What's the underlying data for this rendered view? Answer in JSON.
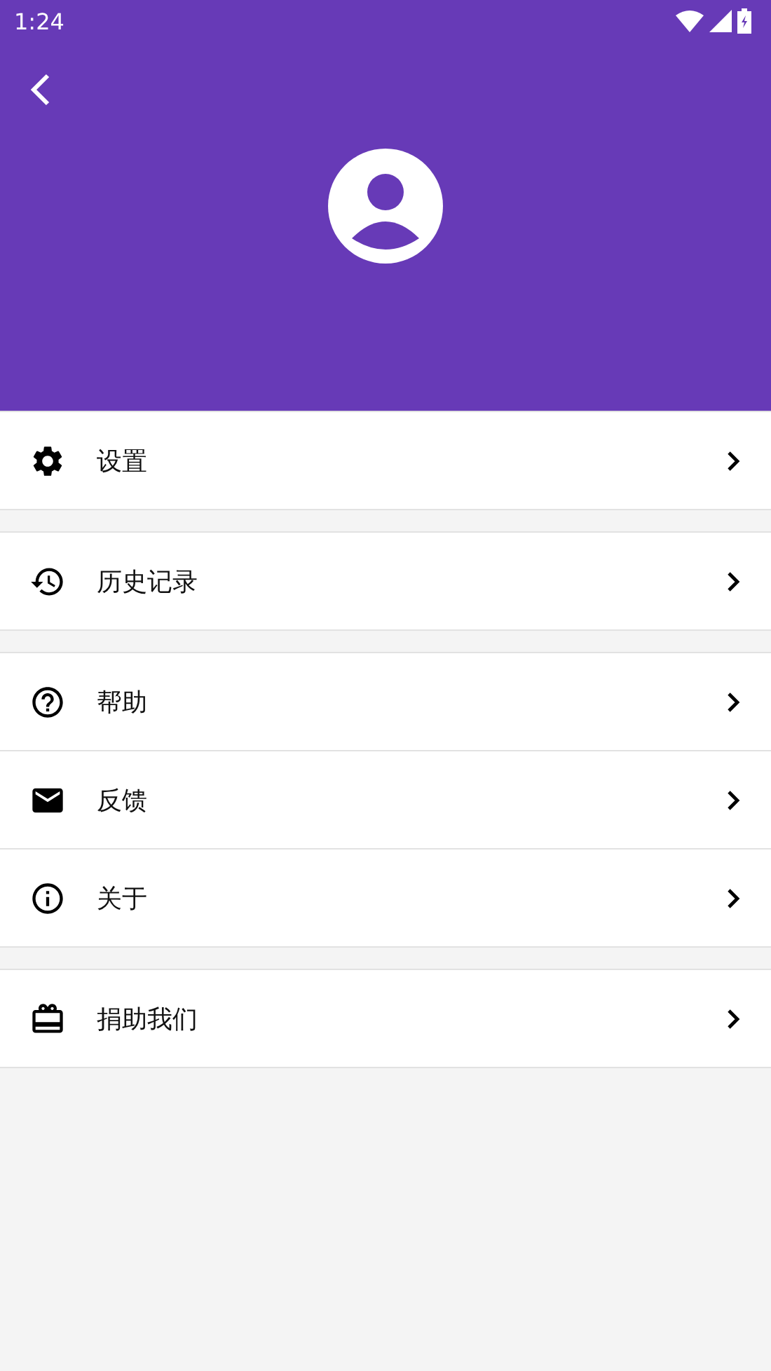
{
  "status_bar": {
    "time": "1:24"
  },
  "groups": [
    {
      "items": [
        {
          "label": "设置"
        }
      ]
    },
    {
      "items": [
        {
          "label": "历史记录"
        }
      ]
    },
    {
      "items": [
        {
          "label": "帮助"
        },
        {
          "label": "反馈"
        },
        {
          "label": "关于"
        }
      ]
    },
    {
      "items": [
        {
          "label": "捐助我们"
        }
      ]
    }
  ]
}
